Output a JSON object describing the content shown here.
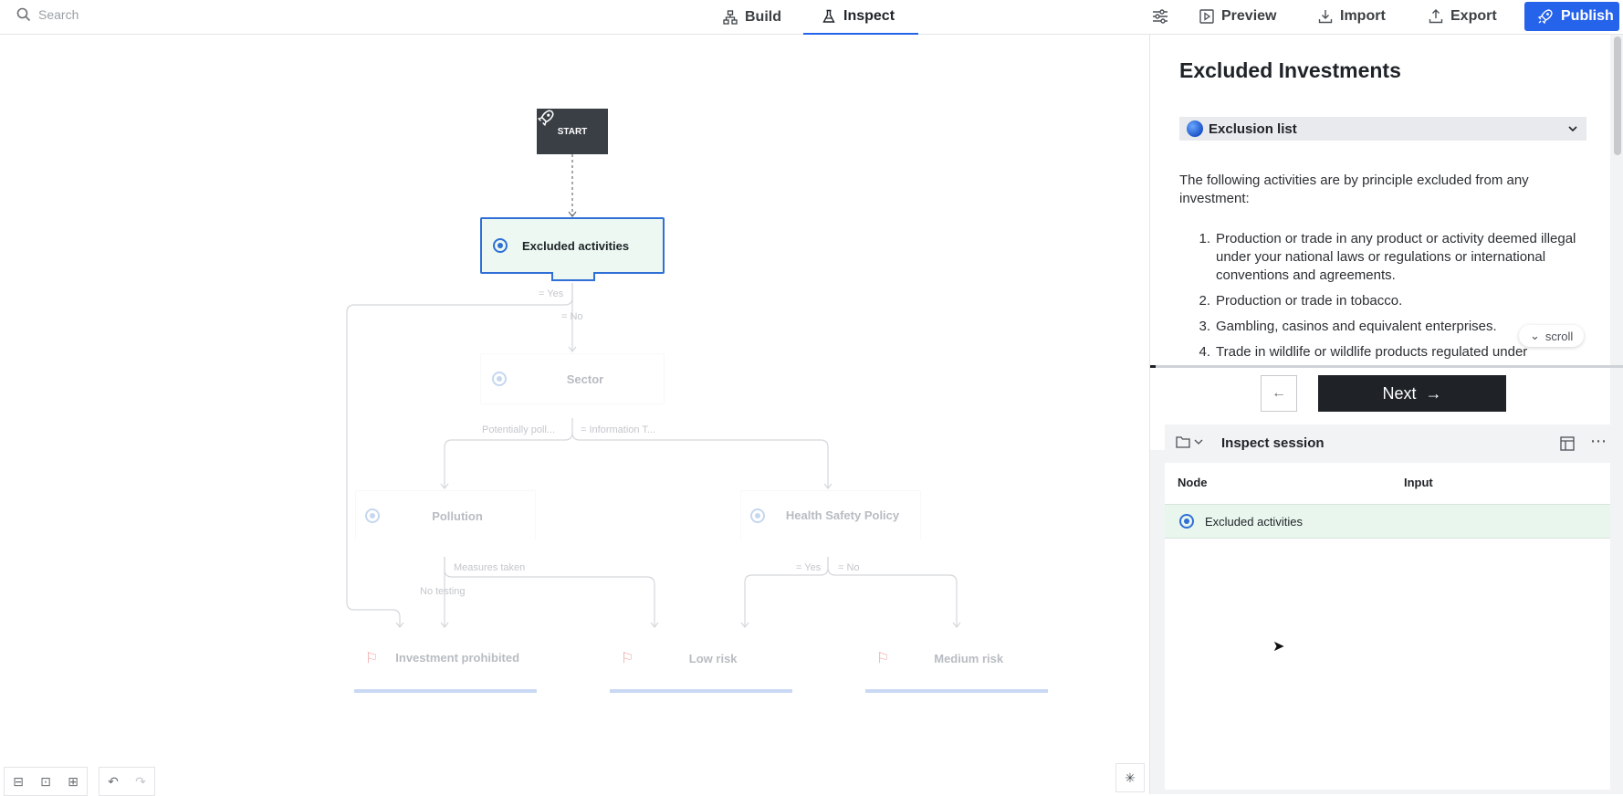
{
  "topbar": {
    "search_placeholder": "Search",
    "tabs": [
      {
        "label": "Build"
      },
      {
        "label": "Inspect"
      }
    ],
    "actions": {
      "preview": "Preview",
      "import": "Import",
      "export": "Export",
      "publish": "Publish"
    }
  },
  "canvas": {
    "start_label": "START",
    "nodes": {
      "excluded": "Excluded activities",
      "sector": "Sector",
      "pollution": "Pollution",
      "health": "Health Safety Policy",
      "prohibited": "Investment prohibited",
      "low": "Low risk",
      "medium": "Medium risk"
    },
    "edges": {
      "yes1": "= Yes",
      "no1": "= No",
      "potentially": "Potentially poll...",
      "infotech": "= Information T...",
      "measures": "Measures taken",
      "notesting": "No testing",
      "yes2": "= Yes",
      "no2": "= No"
    }
  },
  "content": {
    "title": "Excluded Investments",
    "accordion": "Exclusion list",
    "intro": "The following activities are by principle excluded from any investment:",
    "items": [
      {
        "num": "1.",
        "text": "Production or trade in any product or activity deemed illegal under your national laws or regulations or international conventions and agreements."
      },
      {
        "num": "2.",
        "text": "Production or trade in tobacco."
      },
      {
        "num": "3.",
        "text": "Gambling, casinos and equivalent enterprises."
      },
      {
        "num": "4.",
        "text": "Trade in wildlife or wildlife products regulated under"
      }
    ],
    "scroll_hint": "scroll",
    "next_label": "Next"
  },
  "session": {
    "title": "Inspect session",
    "columns": {
      "node": "Node",
      "input": "Input"
    },
    "rows": [
      {
        "node": "Excluded activities",
        "input": ""
      }
    ]
  }
}
